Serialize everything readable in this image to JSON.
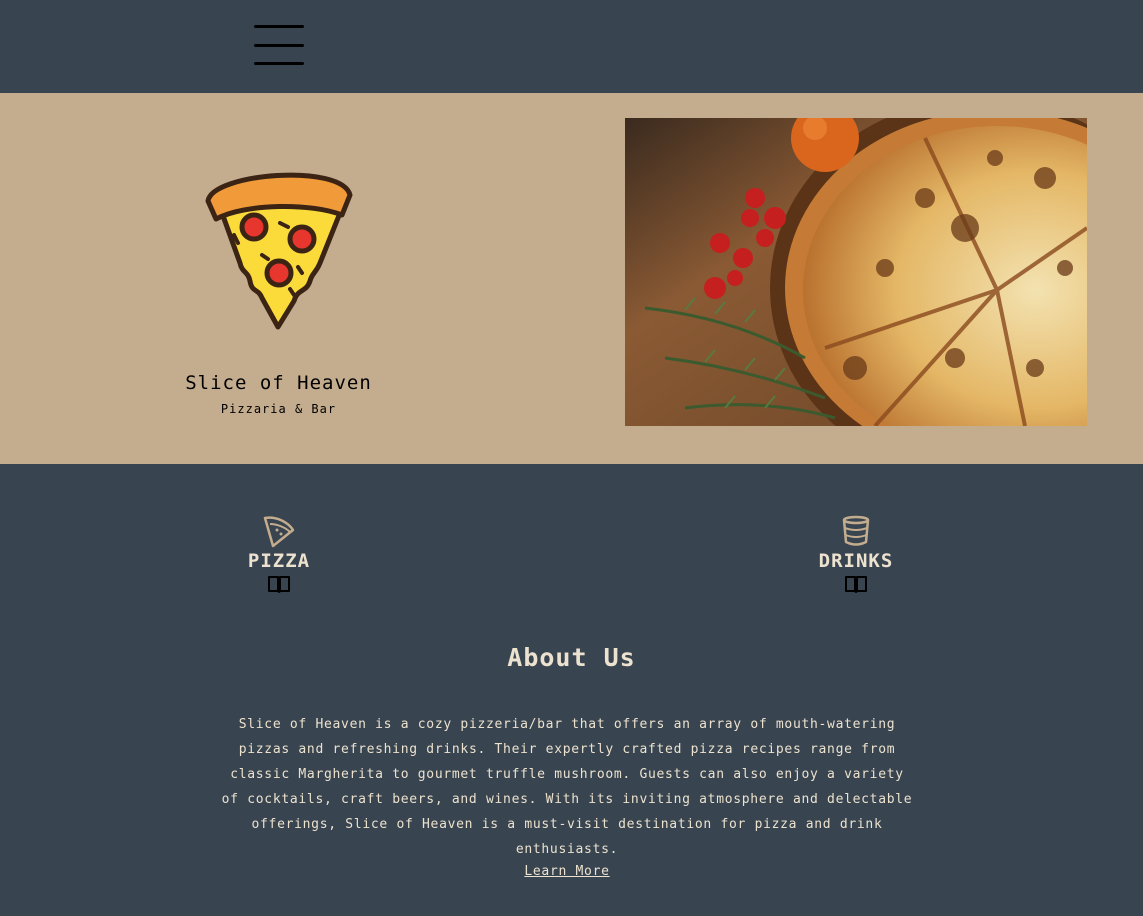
{
  "header": {
    "menu_icon": "hamburger-menu-icon"
  },
  "hero": {
    "logo_icon": "pizza-slice-logo",
    "brand_name": "Slice of Heaven",
    "tagline": "Pizzaria & Bar",
    "photo": "pizza-photo"
  },
  "menu": {
    "categories": [
      {
        "label": "PIZZA",
        "icon": "pizza-slice-icon",
        "action_icon": "open-book-icon"
      },
      {
        "label": "DRINKS",
        "icon": "cup-icon",
        "action_icon": "open-book-icon"
      }
    ]
  },
  "about": {
    "title": "About Us",
    "body": "Slice of Heaven is a cozy pizzeria/bar that offers an array of mouth-watering pizzas and refreshing drinks. Their expertly crafted pizza recipes range from classic Margherita to gourmet truffle mushroom. Guests can also enjoy a variety of cocktails, craft beers, and wines. With its inviting atmosphere and delectable offerings, Slice of Heaven is a must-visit destination for pizza and drink enthusiasts.",
    "link_label": "Learn More"
  },
  "colors": {
    "header_bg": "#38444f",
    "hero_bg": "#c4ad8e",
    "text_light": "#ece2cf",
    "icon_tan": "#c4ad8e"
  }
}
